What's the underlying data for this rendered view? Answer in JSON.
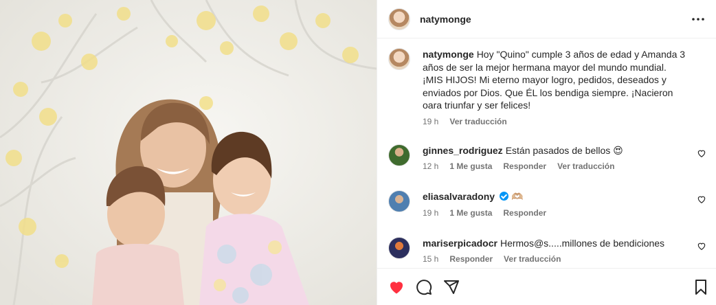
{
  "post": {
    "username": "natymonge",
    "more_icon": "more-horizontal-icon"
  },
  "caption": {
    "username": "natymonge",
    "text": "Hoy \"Quino\" cumple 3 años de edad y Amanda 3 años de ser la mejor hermana mayor del mundo mundial. ¡MIS HIJOS! Mi eterno mayor logro, pedidos, deseados y enviados por Dios. Que ÉL los bendiga siempre. ¡Nacieron oara triunfar y ser felices!",
    "time": "19 h",
    "translate": "Ver traducción"
  },
  "comments": [
    {
      "username": "ginnes_rodriguez",
      "text": "Están pasados de bellos 😍",
      "time": "12 h",
      "likes": "1 Me gusta",
      "reply": "Responder",
      "translate": "Ver traducción",
      "avatar_color": "#3f6b2e"
    },
    {
      "username": "eliasalvaradony",
      "text": "🫶🏼",
      "time": "19 h",
      "likes": "1 Me gusta",
      "reply": "Responder",
      "verified": true,
      "avatar_color": "#4f7fb0"
    },
    {
      "username": "mariserpicadocr",
      "text": "Hermos@s.....millones de bendiciones",
      "time": "15 h",
      "reply": "Responder",
      "translate": "Ver traducción",
      "avatar_color": "#2c2f5e"
    }
  ],
  "actions": {
    "like_icon": "heart-filled-icon",
    "comment_icon": "comment-icon",
    "share_icon": "share-icon",
    "save_icon": "bookmark-icon",
    "like_color": "#ff3040"
  }
}
